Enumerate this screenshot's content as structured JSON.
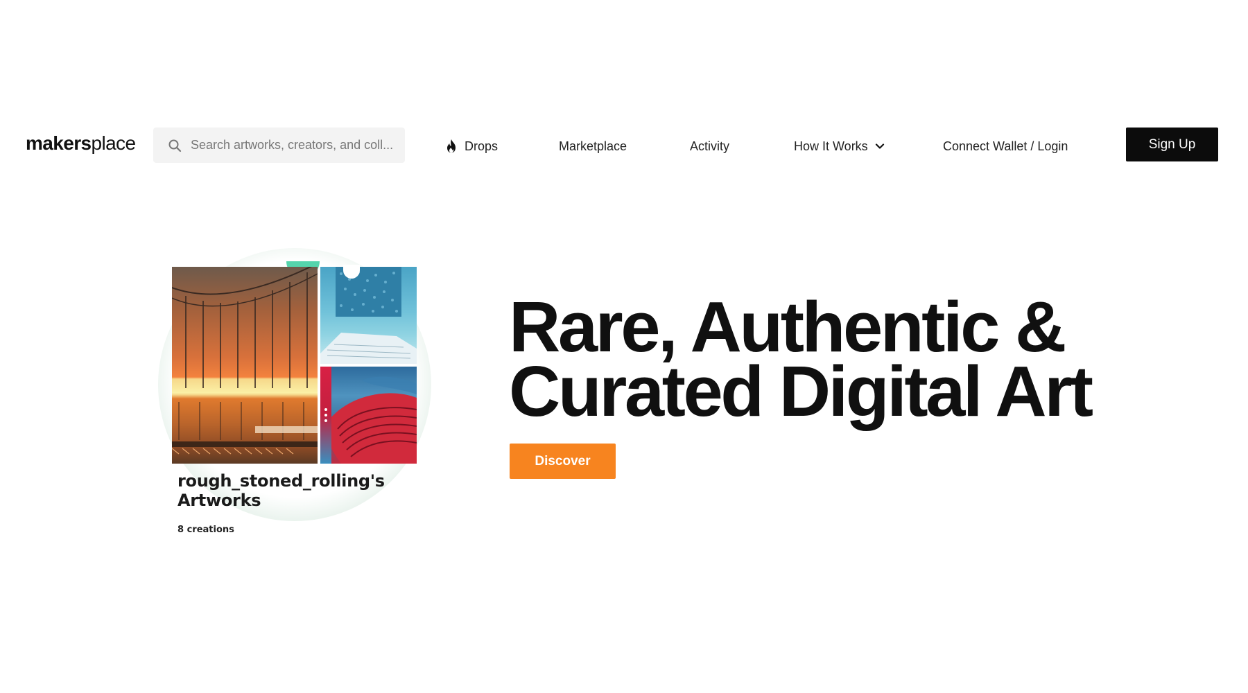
{
  "header": {
    "logo": {
      "bold": "makers",
      "light": "place"
    },
    "search": {
      "placeholder": "Search artworks, creators, and coll..."
    },
    "nav": {
      "drops": "Drops",
      "marketplace": "Marketplace",
      "activity": "Activity",
      "how_it_works": "How It Works",
      "connect": "Connect Wallet / Login"
    },
    "signup_label": "Sign Up"
  },
  "hero": {
    "card": {
      "title": "rough_stoned_rolling's Artworks",
      "subtitle": "8 creations"
    },
    "headline": {
      "line1": "Rare, Authentic &",
      "line2": "Curated Digital Art"
    },
    "cta_label": "Discover"
  },
  "colors": {
    "accent": "#f7841f",
    "signup_bg": "#0c0c0c",
    "text": "#101010",
    "search_bg": "#f3f3f3"
  },
  "icons": {
    "search": "search-icon",
    "drops": "fire-icon",
    "how_it_works": "chevron-down-icon",
    "card_menu": "kebab-menu-icon"
  }
}
